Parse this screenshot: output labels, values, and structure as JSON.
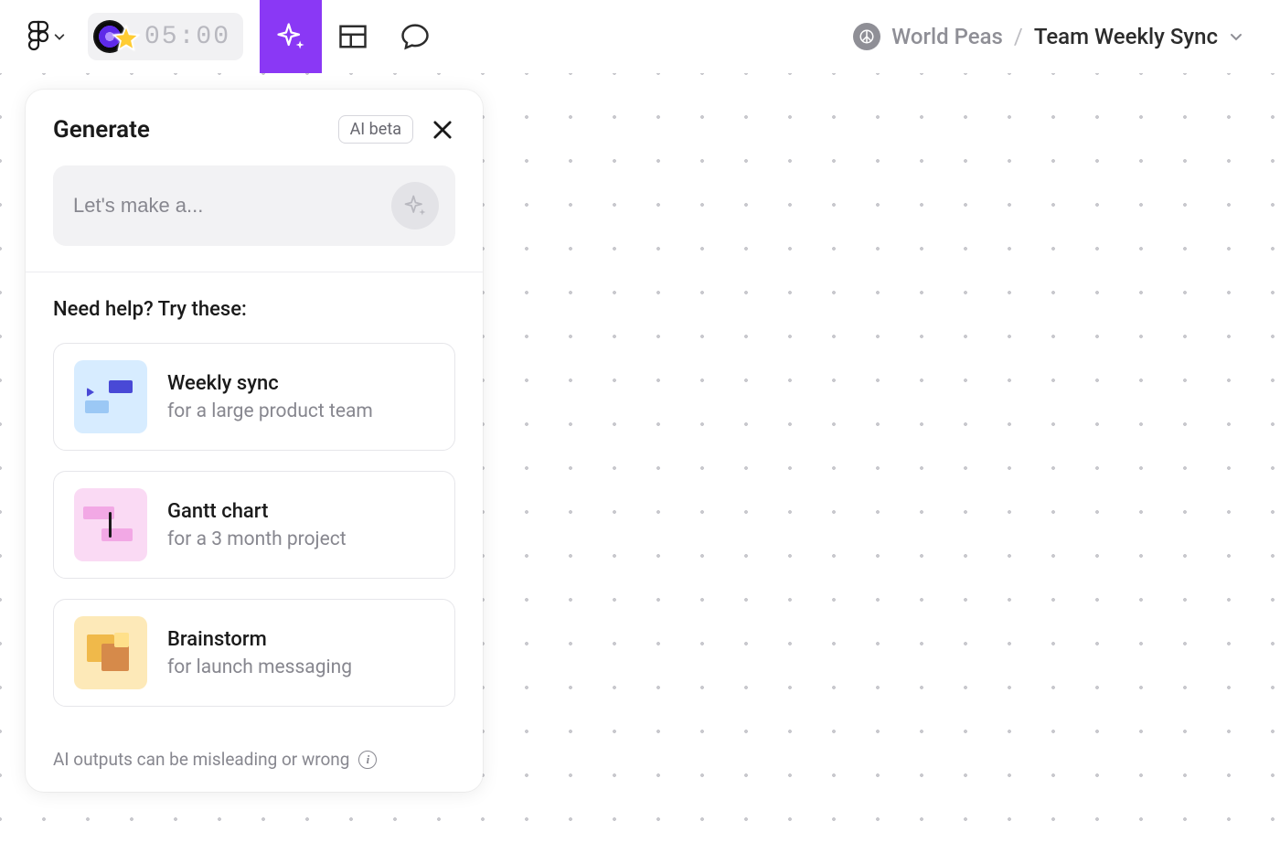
{
  "toolbar": {
    "timer": "05:00"
  },
  "breadcrumb": {
    "team": "World Peas",
    "separator": "/",
    "file": "Team Weekly Sync"
  },
  "panel": {
    "title": "Generate",
    "badge": "AI beta",
    "prompt_placeholder": "Let's make a...",
    "help_heading": "Need help? Try these:",
    "suggestions": [
      {
        "title": "Weekly sync",
        "subtitle": "for a large product team"
      },
      {
        "title": "Gantt chart",
        "subtitle": "for a 3 month project"
      },
      {
        "title": "Brainstorm",
        "subtitle": "for launch messaging"
      }
    ],
    "disclaimer": "AI outputs can be misleading or wrong"
  }
}
